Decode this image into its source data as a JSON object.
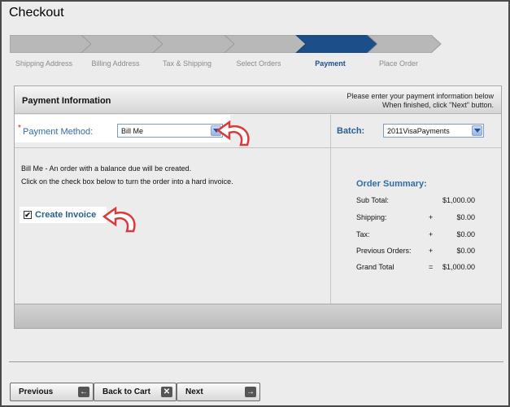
{
  "title": "Checkout",
  "steps": [
    {
      "label": "Shipping Address",
      "active": false
    },
    {
      "label": "Billing Address",
      "active": false
    },
    {
      "label": "Tax & Shipping",
      "active": false
    },
    {
      "label": "Select Orders",
      "active": false
    },
    {
      "label": "Payment",
      "active": true
    },
    {
      "label": "Place Order",
      "active": false
    }
  ],
  "panel": {
    "title": "Payment Information",
    "hint_line1": "Please enter your payment information below",
    "hint_line2": "When finished, click \"Next\" button."
  },
  "payment_method": {
    "required_mark": "*",
    "label": "Payment Method:",
    "value": "Bill Me"
  },
  "batch": {
    "label": "Batch:",
    "value": "2011VisaPayments"
  },
  "description": {
    "line1": "Bill Me - An order with a balance due will be created.",
    "line2": "Click on the check box below to turn the order into a hard invoice."
  },
  "invoice": {
    "checked_mark": "✔",
    "label": "Create Invoice"
  },
  "summary": {
    "title": "Order Summary:",
    "rows": [
      {
        "label": "Sub Total:",
        "op": "",
        "value": "$1,000.00"
      },
      {
        "label": "Shipping:",
        "op": "+",
        "value": "$0.00"
      },
      {
        "label": "Tax:",
        "op": "+",
        "value": "$0.00"
      },
      {
        "label": "Previous Orders:",
        "op": "+",
        "value": "$0.00"
      },
      {
        "label": "Grand Total",
        "op": "=",
        "value": "$1,000.00"
      }
    ]
  },
  "buttons": {
    "previous": {
      "label": "Previous",
      "icon": "←"
    },
    "back_to_cart": {
      "label": "Back to Cart",
      "icon": "✕"
    },
    "next": {
      "label": "Next",
      "icon": "→"
    }
  },
  "colors": {
    "active_step": "#1c4f8a",
    "inactive_step": "#b8b8b8",
    "label_blue": "#2f6da6",
    "required_red": "#d21c1c",
    "annotation_red": "#d93a3a"
  }
}
